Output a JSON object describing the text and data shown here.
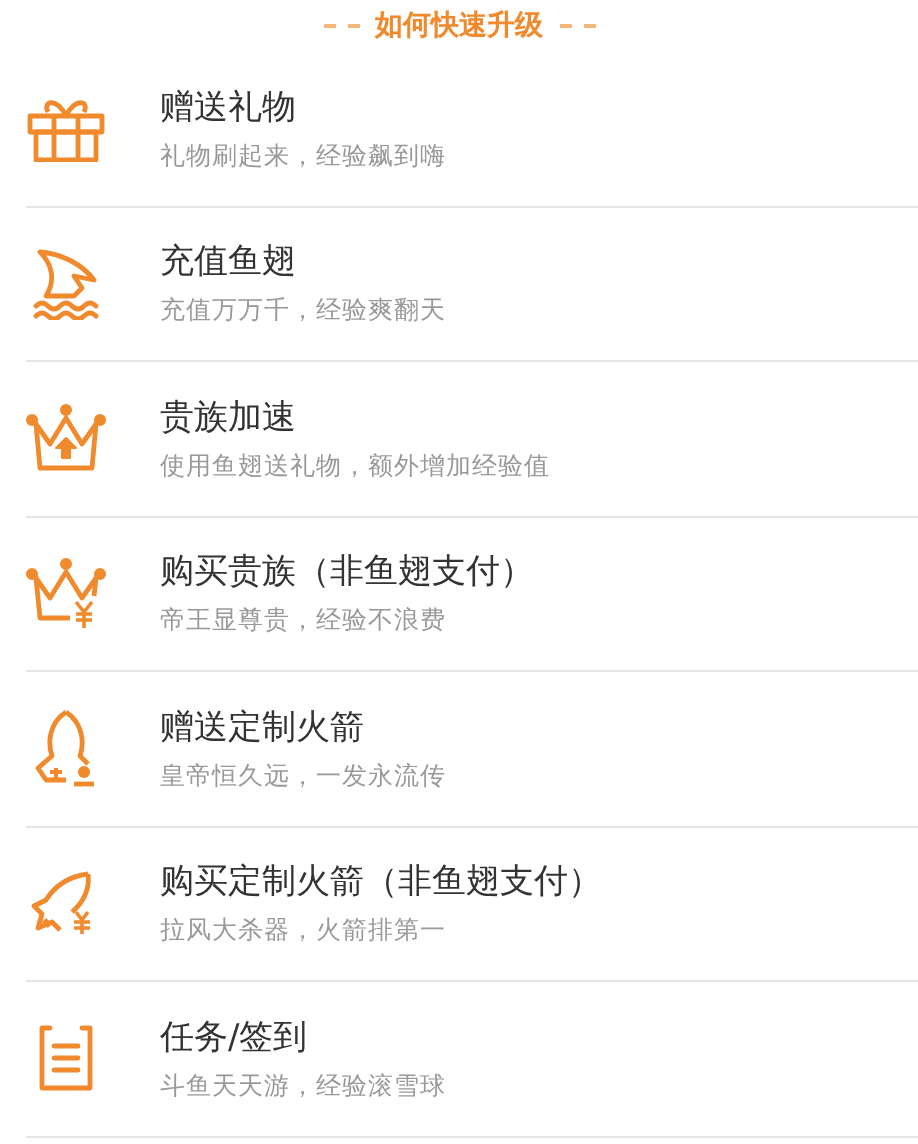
{
  "header": {
    "title": "如何快速升级"
  },
  "items": [
    {
      "kind": "gift",
      "title": "赠送礼物",
      "subtitle": "礼物刷起来，经验飙到嗨"
    },
    {
      "kind": "fin",
      "title": "充值鱼翅",
      "subtitle": "充值万万千，经验爽翻天"
    },
    {
      "kind": "crown-up",
      "title": "贵族加速",
      "subtitle": "使用鱼翅送礼物，额外增加经验值"
    },
    {
      "kind": "crown-yen",
      "title": "购买贵族（非鱼翅支付）",
      "subtitle": "帝王显尊贵，经验不浪费"
    },
    {
      "kind": "rocket",
      "title": "赠送定制火箭",
      "subtitle": "皇帝恒久远，一发永流传"
    },
    {
      "kind": "rocket-yen",
      "title": "购买定制火箭（非鱼翅支付）",
      "subtitle": "拉风大杀器，火箭排第一"
    },
    {
      "kind": "task",
      "title": "任务/签到",
      "subtitle": "斗鱼天天游，经验滚雪球"
    }
  ]
}
